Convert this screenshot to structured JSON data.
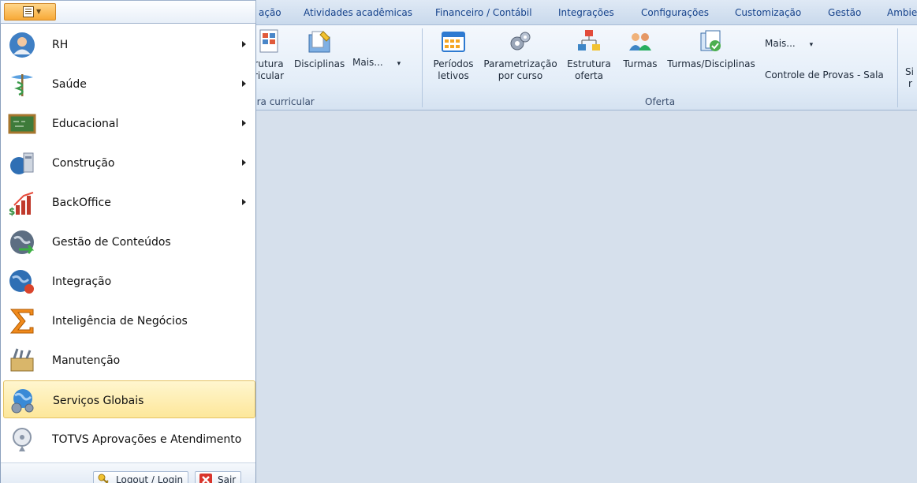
{
  "tabs": [
    "ação",
    "Atividades acadêmicas",
    "Financeiro / Contábil",
    "Integrações",
    "Configurações",
    "Customização",
    "Gestão",
    "Ambie"
  ],
  "ribbon": {
    "partial_buttons": [
      {
        "line1": "rutura",
        "line2": "ricular"
      }
    ],
    "disciplinas": "Disciplinas",
    "mais1": "Mais...",
    "group1_label": "ura curricular",
    "buttons": [
      {
        "line1": "Períodos",
        "line2": "letivos"
      },
      {
        "line1": "Parametrização",
        "line2": "por curso"
      },
      {
        "line1": "Estrutura",
        "line2": "oferta"
      },
      {
        "line1": "Turmas",
        "line2": ""
      },
      {
        "line1": "Turmas/Disciplinas",
        "line2": ""
      }
    ],
    "mais2": "Mais...",
    "controle": "Controle de Provas - Sala",
    "group2_label": "Oferta",
    "cut_right": {
      "line1": "Si",
      "line2": "r"
    }
  },
  "menu": {
    "items": [
      {
        "label": "RH",
        "icon": "rh-person-icon",
        "submenu": true
      },
      {
        "label": "Saúde",
        "icon": "caduceus-icon",
        "submenu": true
      },
      {
        "label": "Educacional",
        "icon": "chalkboard-icon",
        "submenu": true
      },
      {
        "label": "Construção",
        "icon": "construction-icon",
        "submenu": true
      },
      {
        "label": "BackOffice",
        "icon": "chart-dollar-icon",
        "submenu": true
      },
      {
        "label": "Gestão de Conteúdos",
        "icon": "globe-arrow-icon",
        "submenu": false
      },
      {
        "label": "Integração",
        "icon": "globe-plug-icon",
        "submenu": false
      },
      {
        "label": "Inteligência de Negócios",
        "icon": "sigma-icon",
        "submenu": false
      },
      {
        "label": "Manutenção",
        "icon": "toolbox-icon",
        "submenu": false
      },
      {
        "label": "Serviços Globais",
        "icon": "globe-services-icon",
        "submenu": false
      },
      {
        "label": "TOTVS Aprovações e Atendimento",
        "icon": "satellite-dish-icon",
        "submenu": false
      }
    ],
    "footer": {
      "logout": "Logout / Login",
      "exit": "Sair"
    }
  },
  "colors": {
    "selected_bg": "#fde79a",
    "accent": "#f7a937"
  }
}
